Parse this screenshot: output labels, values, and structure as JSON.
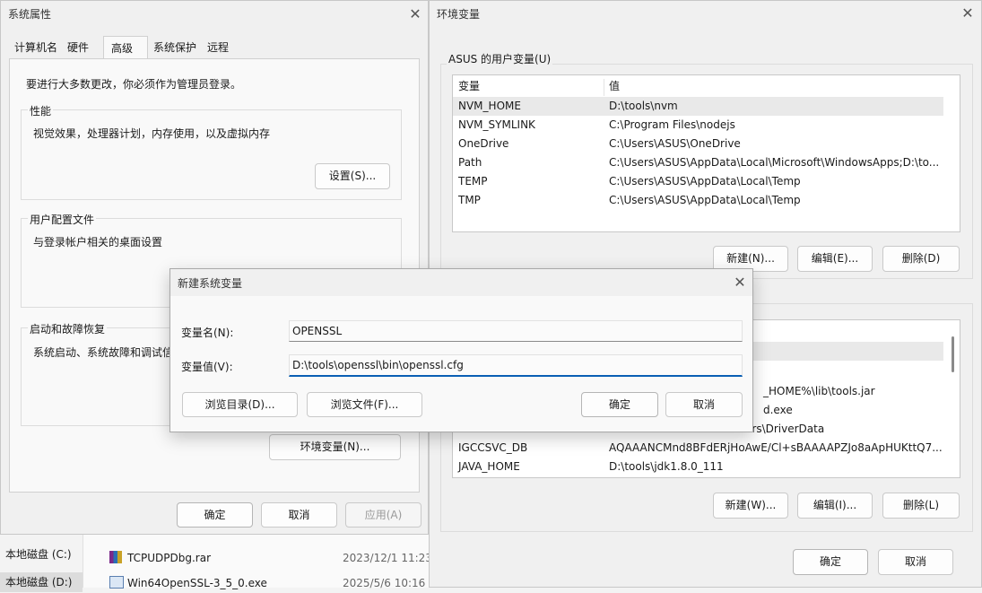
{
  "sysprops": {
    "title": "系统属性",
    "tabs": [
      "计算机名",
      "硬件",
      "高级",
      "系统保护",
      "远程"
    ],
    "admin_note": "要进行大多数更改，你必须作为管理员登录。",
    "performance": {
      "label": "性能",
      "desc": "视觉效果，处理器计划，内存使用，以及虚拟内存",
      "button": "设置(S)..."
    },
    "profiles": {
      "label": "用户配置文件",
      "desc": "与登录帐户相关的桌面设置"
    },
    "startup": {
      "label": "启动和故障恢复",
      "desc": "系统启动、系统故障和调试信"
    },
    "env_button": "环境变量(N)...",
    "ok": "确定",
    "cancel": "取消",
    "apply": "应用(A)"
  },
  "envvars": {
    "title": "环境变量",
    "user_label": "ASUS 的用户变量(U)",
    "col_var": "变量",
    "col_val": "值",
    "user_vars": [
      {
        "name": "NVM_HOME",
        "value": "D:\\tools\\nvm"
      },
      {
        "name": "NVM_SYMLINK",
        "value": "C:\\Program Files\\nodejs"
      },
      {
        "name": "OneDrive",
        "value": "C:\\Users\\ASUS\\OneDrive"
      },
      {
        "name": "Path",
        "value": "C:\\Users\\ASUS\\AppData\\Local\\Microsoft\\WindowsApps;D:\\to..."
      },
      {
        "name": "TEMP",
        "value": "C:\\Users\\ASUS\\AppData\\Local\\Temp"
      },
      {
        "name": "TMP",
        "value": "C:\\Users\\ASUS\\AppData\\Local\\Temp"
      }
    ],
    "user_new": "新建(N)...",
    "user_edit": "编辑(E)...",
    "user_delete": "删除(D)",
    "sys_partial": [
      {
        "value": "_HOME%\\lib\\tools.jar"
      },
      {
        "value": "d.exe"
      },
      {
        "value": "ers\\DriverData"
      }
    ],
    "sys_vars": [
      {
        "name": "IGCCSVC_DB",
        "value": "AQAAANCMnd8BFdERjHoAwE/Cl+sBAAAAPZJo8aApHUKttQ7..."
      },
      {
        "name": "JAVA_HOME",
        "value": "D:\\tools\\jdk1.8.0_111"
      }
    ],
    "sys_new": "新建(W)...",
    "sys_edit": "编辑(I)...",
    "sys_delete": "删除(L)",
    "ok": "确定",
    "cancel": "取消"
  },
  "newvar": {
    "title": "新建系统变量",
    "name_label": "变量名(N):",
    "name_value": "OPENSSL",
    "value_label": "变量值(V):",
    "value_value": "D:\\tools\\openssl\\bin\\openssl.cfg",
    "browse_dir": "浏览目录(D)...",
    "browse_file": "浏览文件(F)...",
    "ok": "确定",
    "cancel": "取消"
  },
  "explorer": {
    "drives": [
      "本地磁盘 (C:)",
      "本地磁盘 (D:)"
    ],
    "files": [
      {
        "name": "TCPUDPDbg.rar",
        "date": "2023/12/1 11:23"
      },
      {
        "name": "Win64OpenSSL-3_5_0.exe",
        "date": "2025/5/6 10:16"
      }
    ]
  }
}
